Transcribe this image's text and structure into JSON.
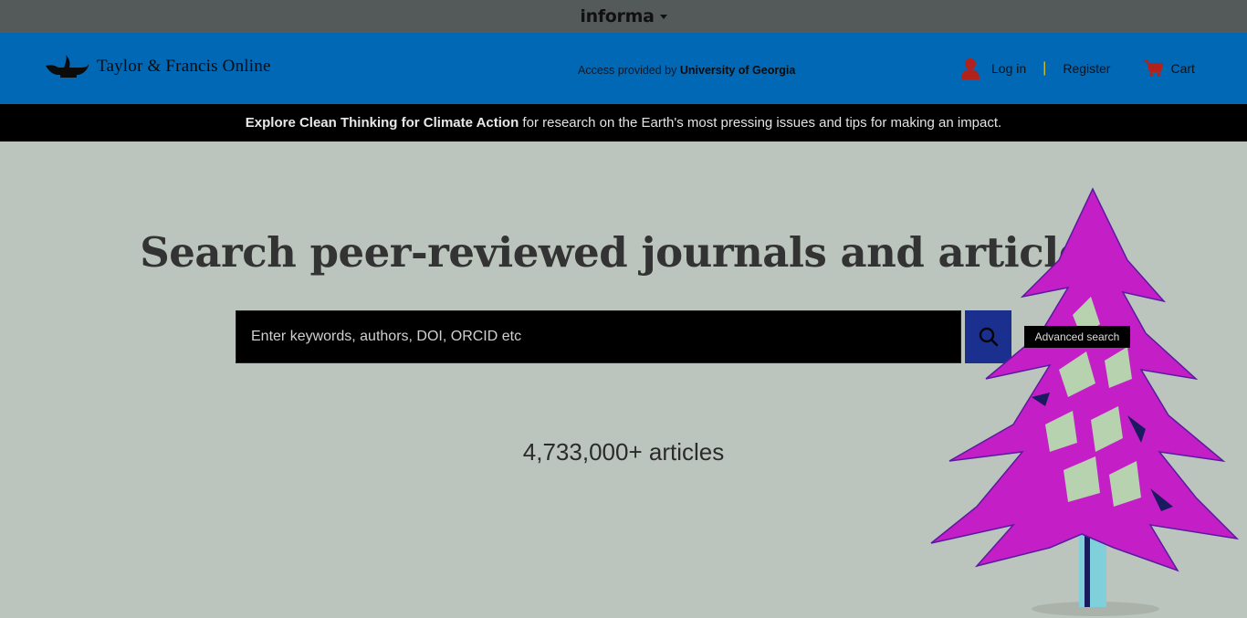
{
  "topbar": {
    "brand": "informa"
  },
  "header": {
    "logo_text": "Taylor & Francis Online",
    "access_prefix": "Access provided by",
    "institution": "University of Georgia",
    "login_label": "Log in",
    "separator": "|",
    "register_label": "Register",
    "cart_label": "Cart"
  },
  "banner": {
    "highlight": "Explore Clean Thinking for Climate Action",
    "rest": " for research on the Earth's most pressing issues and tips for making an impact."
  },
  "hero": {
    "title": "Search peer-reviewed journals and articles",
    "search_placeholder": "Enter keywords, authors, DOI, ORCID etc",
    "advanced_search_label": "Advanced search",
    "article_count": "4,733,000+ articles"
  },
  "colors": {
    "topbar": "#545a5a",
    "header": "#0068b5",
    "banner": "#000000",
    "page": "#bcc5bd",
    "search_button": "#1a2f8e",
    "tree": "#c41fc6"
  },
  "icons": {
    "logo": "lamp-logo-icon",
    "user": "user-icon",
    "cart": "cart-icon",
    "search": "search-icon",
    "caret": "chevron-down-icon"
  }
}
